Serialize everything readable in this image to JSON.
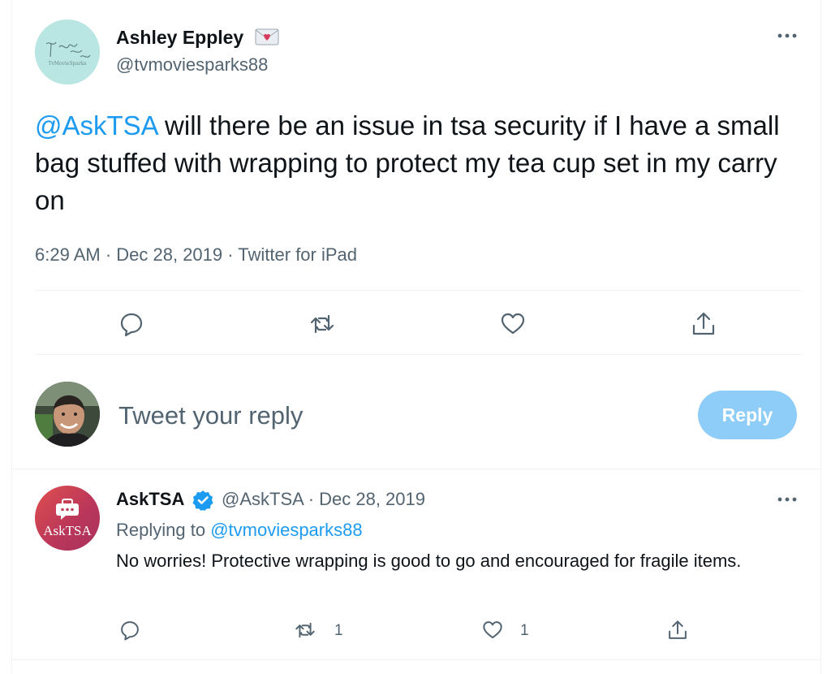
{
  "tweet": {
    "author": {
      "name": "Ashley Eppley",
      "handle": "@tvmoviesparks88",
      "avatar_text": "TvMovieSparks"
    },
    "text_mention": "@AskTSA",
    "text_body": " will there be an issue in tsa security if I have a small bag stuffed with wrapping to protect my tea cup set in my carry on",
    "meta": "6:29 AM · Dec 28, 2019 · Twitter for iPad",
    "actions": [
      "reply-icon",
      "retweet-icon",
      "like-icon",
      "share-icon"
    ]
  },
  "composer": {
    "placeholder": "Tweet your reply",
    "button_label": "Reply"
  },
  "reply": {
    "author": {
      "name": "AskTSA",
      "handle": "@AskTSA",
      "verified": true,
      "avatar_text": "AskTSA"
    },
    "date": "Dec 28, 2019",
    "handle_date": "@AskTSA · Dec 28, 2019",
    "replying_prefix": "Replying to ",
    "replying_to": "@tvmoviesparks88",
    "text": "No worries! Protective wrapping is good to go and encouraged for fragile items.",
    "retweet_count": "1",
    "like_count": "1"
  },
  "colors": {
    "accent": "#1d9bf0",
    "reply_button": "#8ecdf8",
    "secondary_text": "#536471",
    "divider": "#eff3f4"
  }
}
